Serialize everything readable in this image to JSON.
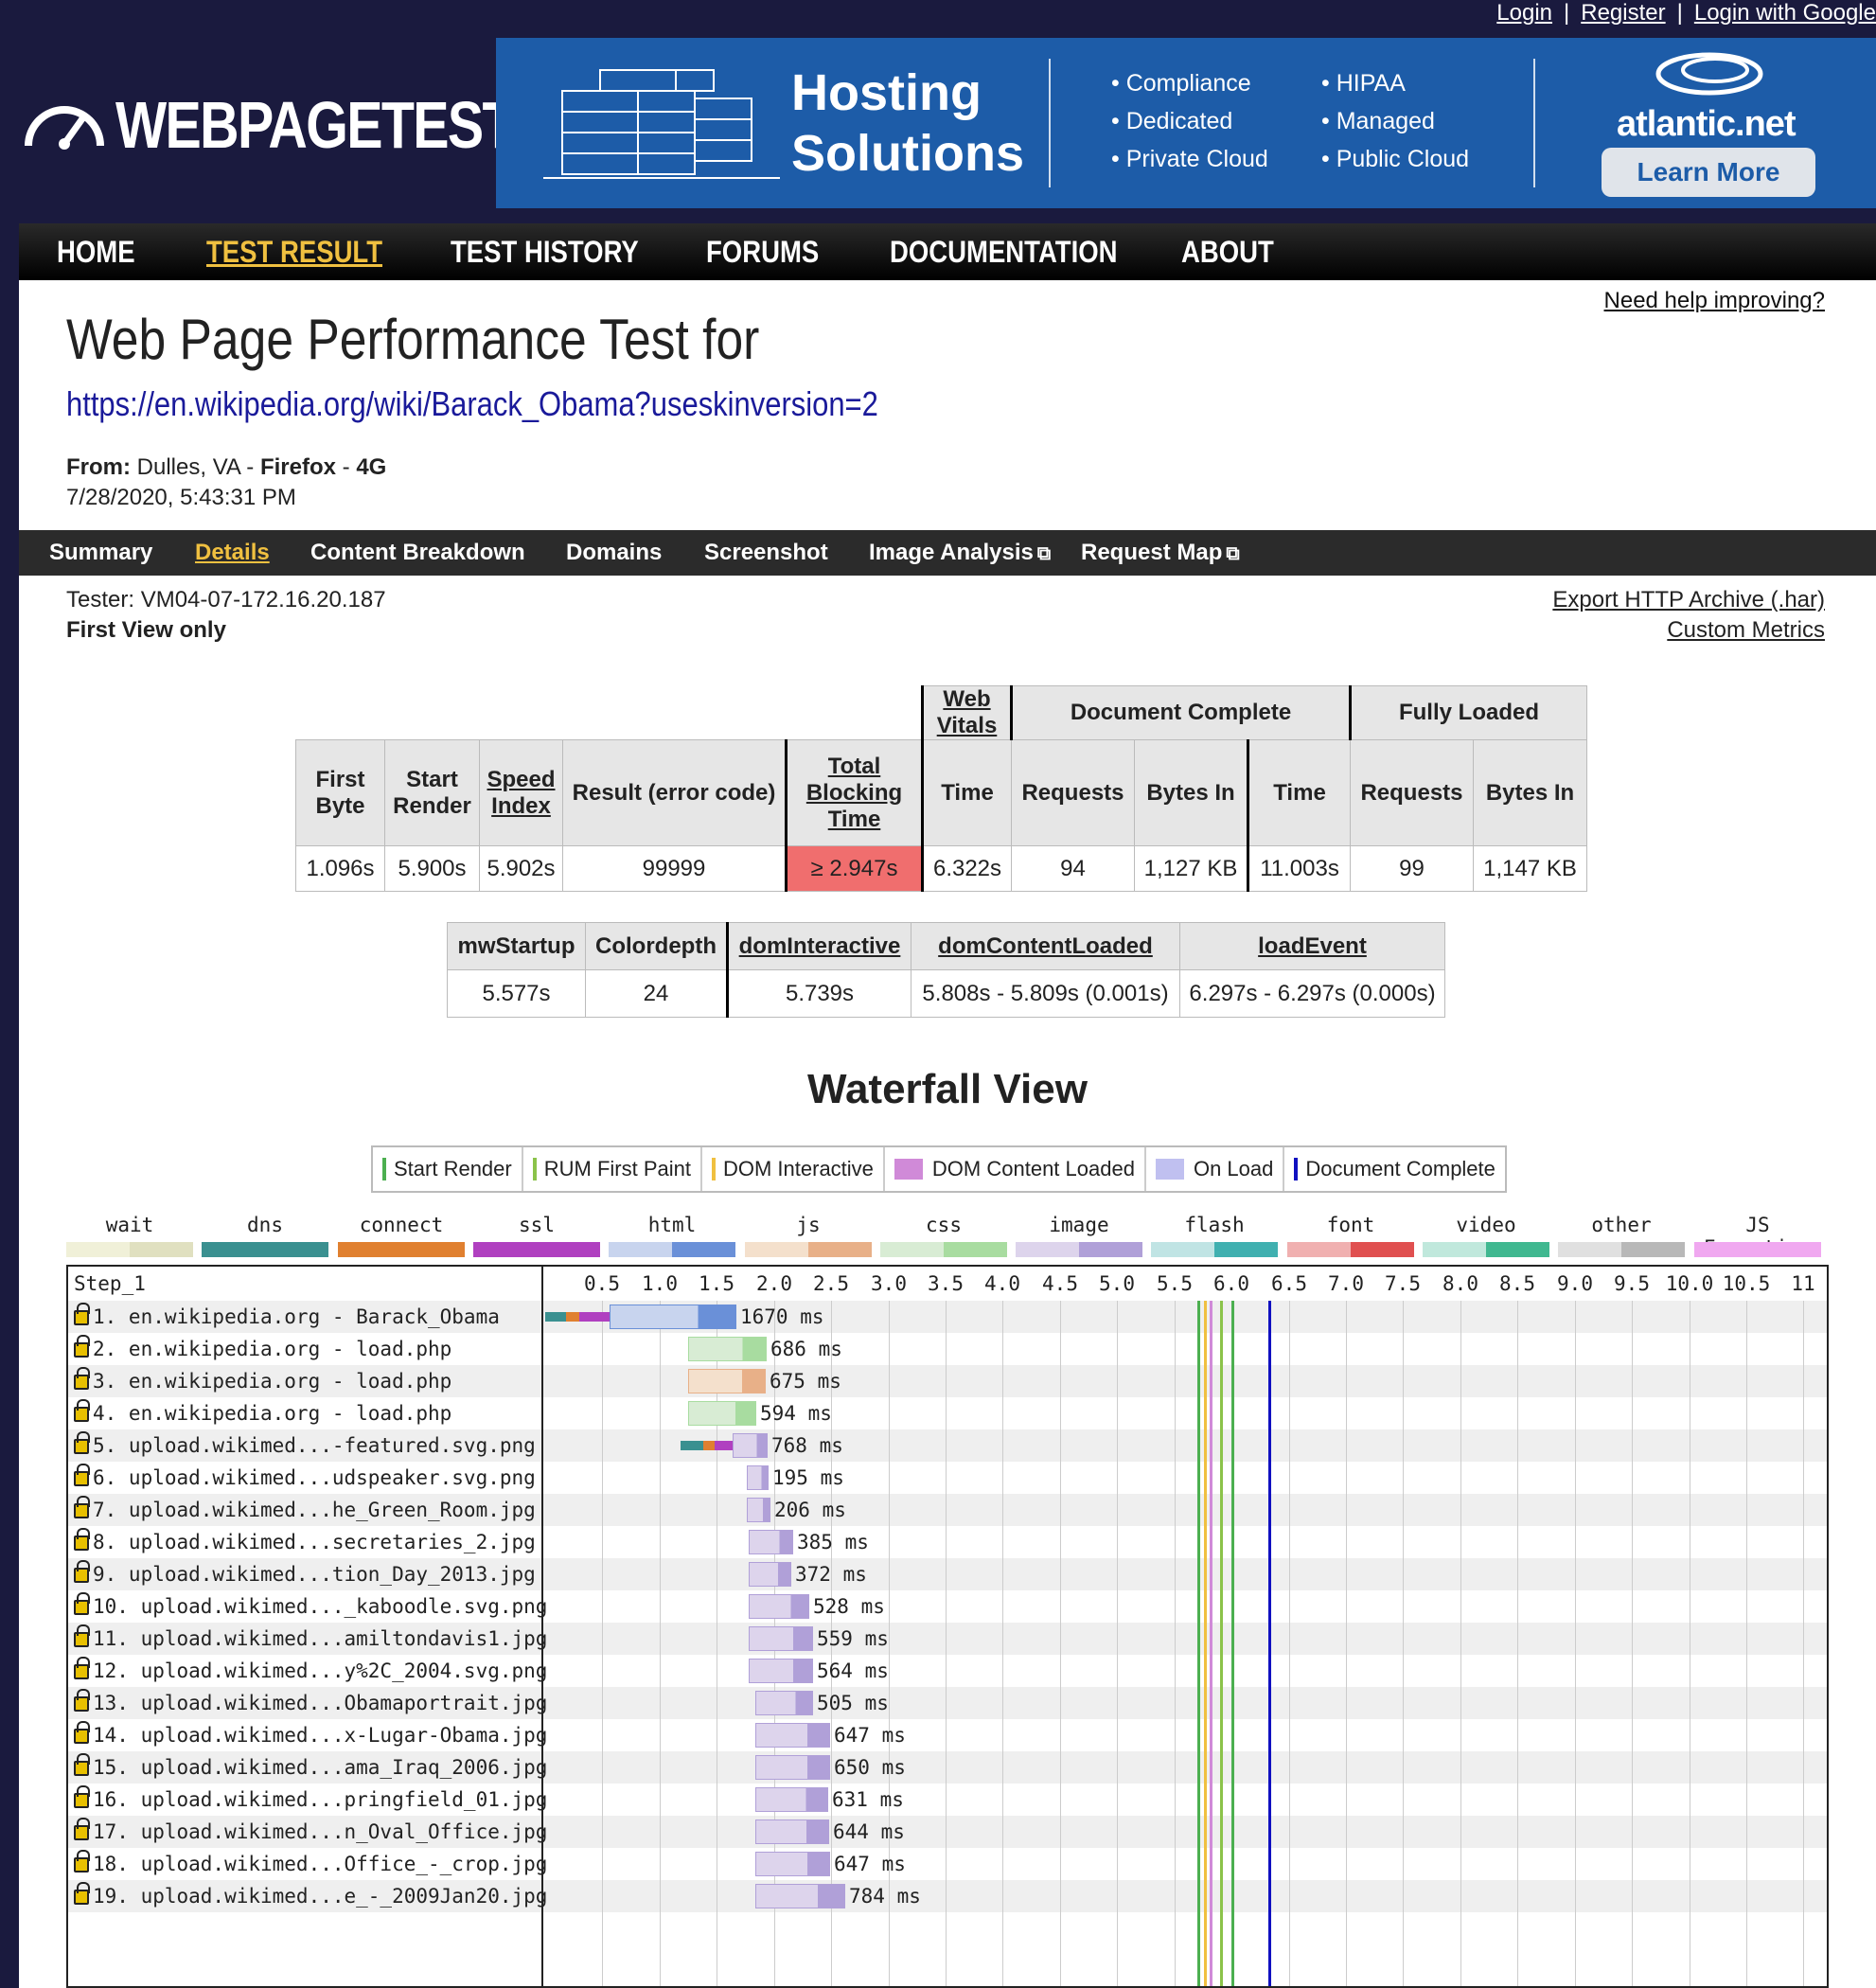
{
  "top_links": {
    "login": "Login",
    "register": "Register",
    "google": "Login with Google",
    "sep": "|"
  },
  "logo": {
    "text": "WEBPAGETEST",
    "icon": "speedometer-icon"
  },
  "ad": {
    "headline_1": "Hosting",
    "headline_2": "Solutions",
    "col1": [
      "Compliance",
      "Dedicated",
      "Private Cloud"
    ],
    "col2": [
      "HIPAA",
      "Managed",
      "Public Cloud"
    ],
    "brand": "atlantic.net",
    "cta": "Learn More",
    "icon": "server-rack-icon",
    "bg": "#1d5ca8"
  },
  "nav": {
    "items": [
      "HOME",
      "TEST RESULT",
      "TEST HISTORY",
      "FORUMS",
      "DOCUMENTATION",
      "ABOUT"
    ],
    "active": 1,
    "active_color": "#f0c040"
  },
  "help_link": "Need help improving?",
  "page_title": "Web Page Performance Test for",
  "test_url": "https://en.wikipedia.org/wiki/Barack_Obama?useskinversion=2",
  "from": {
    "label": "From:",
    "location": "Dulles, VA -",
    "browser": "Firefox",
    "dash": "-",
    "network": "4G",
    "datetime": "7/28/2020, 5:43:31 PM"
  },
  "tabs": {
    "items": [
      "Summary",
      "Details",
      "Content Breakdown",
      "Domains",
      "Screenshot",
      "Image Analysis",
      "Request Map"
    ],
    "active": 1,
    "external_icon": "external-link-icon"
  },
  "tester": "Tester: VM04-07-172.16.20.187",
  "view": "First View only",
  "export": {
    "har": "Export HTTP Archive (.har)",
    "metrics": "Custom Metrics"
  },
  "summary_table": {
    "group_headers": [
      "Web Vitals",
      "Document Complete",
      "Fully Loaded"
    ],
    "headers": [
      "First Byte",
      "Start Render",
      "Speed Index",
      "Result (error code)",
      "Total Blocking Time",
      "Time",
      "Requests",
      "Bytes In",
      "Time",
      "Requests",
      "Bytes In"
    ],
    "values": [
      "1.096s",
      "5.900s",
      "5.902s",
      "99999",
      "≥ 2.947s",
      "6.322s",
      "94",
      "1,127 KB",
      "11.003s",
      "99",
      "1,147 KB"
    ],
    "alert_color": "#f06e6e"
  },
  "metrics_table": {
    "headers": [
      "mwStartup",
      "Colordepth",
      "domInteractive",
      "domContentLoaded",
      "loadEvent"
    ],
    "values": [
      "5.577s",
      "24",
      "5.739s",
      "5.808s - 5.809s (0.001s)",
      "6.297s - 6.297s (0.000s)"
    ]
  },
  "waterfall": {
    "title": "Waterfall View",
    "event_legend": [
      {
        "label": "Start Render",
        "color": "#4caf50",
        "kind": "line"
      },
      {
        "label": "RUM First Paint",
        "color": "#8bc34a",
        "kind": "line"
      },
      {
        "label": "DOM Interactive",
        "color": "#f0c040",
        "kind": "line"
      },
      {
        "label": "DOM Content Loaded",
        "color": "#d08ad8",
        "kind": "box"
      },
      {
        "label": "On Load",
        "color": "#c0c0f0",
        "kind": "box"
      },
      {
        "label": "Document Complete",
        "color": "#1010c0",
        "kind": "line"
      }
    ],
    "type_legend": [
      {
        "label": "wait",
        "c1": "#f0f0d8",
        "c2": "#e0e0c0"
      },
      {
        "label": "dns",
        "c1": "#3a9090",
        "c2": "#3a9090"
      },
      {
        "label": "connect",
        "c1": "#e08030",
        "c2": "#e08030"
      },
      {
        "label": "ssl",
        "c1": "#b040c0",
        "c2": "#b040c0"
      },
      {
        "label": "html",
        "c1": "#c8d4ee",
        "c2": "#6a90d8"
      },
      {
        "label": "js",
        "c1": "#f4e0cc",
        "c2": "#e8b088"
      },
      {
        "label": "css",
        "c1": "#d8ecd4",
        "c2": "#a8dca0"
      },
      {
        "label": "image",
        "c1": "#ddd4ec",
        "c2": "#b0a0d8"
      },
      {
        "label": "flash",
        "c1": "#c0e4e4",
        "c2": "#40b0b0"
      },
      {
        "label": "font",
        "c1": "#f0b0b0",
        "c2": "#e05050"
      },
      {
        "label": "video",
        "c1": "#c0e8dc",
        "c2": "#40b890"
      },
      {
        "label": "other",
        "c1": "#e0e0e0",
        "c2": "#b8b8b8"
      },
      {
        "label": "JS Execution",
        "c1": "#f0a8f0",
        "c2": "#f0a8f0"
      }
    ],
    "step": "Step_1",
    "ticks": [
      "0.5",
      "1.0",
      "1.5",
      "2.0",
      "2.5",
      "3.0",
      "3.5",
      "4.0",
      "4.5",
      "5.0",
      "5.5",
      "6.0",
      "6.5",
      "7.0",
      "7.5",
      "8.0",
      "8.5",
      "9.0",
      "9.5",
      "10.0",
      "10.5",
      "11"
    ],
    "events": [
      {
        "t": 5.7,
        "color": "#4caf50"
      },
      {
        "t": 5.76,
        "color": "#f0c040"
      },
      {
        "t": 5.81,
        "color": "#d08ad8"
      },
      {
        "t": 5.9,
        "color": "#8bc34a"
      },
      {
        "t": 6.0,
        "color": "#4caf50"
      },
      {
        "t": 6.32,
        "color": "#1010c0"
      }
    ],
    "requests": [
      {
        "label": "1. en.wikipedia.org - Barack_Obama",
        "start": 0.0,
        "dur": 1.67,
        "ms": "1670 ms",
        "type": "html",
        "pre": [
          0.18,
          0.12,
          0.26
        ]
      },
      {
        "label": "2. en.wikipedia.org - load.php",
        "start": 1.25,
        "dur": 0.686,
        "ms": "686 ms",
        "type": "css"
      },
      {
        "label": "3. en.wikipedia.org - load.php",
        "start": 1.25,
        "dur": 0.675,
        "ms": "675 ms",
        "type": "js"
      },
      {
        "label": "4. en.wikipedia.org - load.php",
        "start": 1.25,
        "dur": 0.594,
        "ms": "594 ms",
        "type": "css"
      },
      {
        "label": "5. upload.wikimed...-featured.svg.png",
        "start": 1.18,
        "dur": 0.768,
        "ms": "768 ms",
        "type": "image",
        "pre": [
          0.2,
          0.1,
          0.16
        ]
      },
      {
        "label": "6. upload.wikimed...udspeaker.svg.png",
        "start": 1.76,
        "dur": 0.195,
        "ms": "195 ms",
        "type": "image"
      },
      {
        "label": "7. upload.wikimed...he_Green_Room.jpg",
        "start": 1.76,
        "dur": 0.206,
        "ms": "206 ms",
        "type": "image"
      },
      {
        "label": "8. upload.wikimed...secretaries_2.jpg",
        "start": 1.78,
        "dur": 0.385,
        "ms": "385 ms",
        "type": "image"
      },
      {
        "label": "9. upload.wikimed...tion_Day_2013.jpg",
        "start": 1.78,
        "dur": 0.372,
        "ms": "372 ms",
        "type": "image"
      },
      {
        "label": "10. upload.wikimed..._kaboodle.svg.png",
        "start": 1.78,
        "dur": 0.528,
        "ms": "528 ms",
        "type": "image"
      },
      {
        "label": "11. upload.wikimed...amiltondavis1.jpg",
        "start": 1.78,
        "dur": 0.559,
        "ms": "559 ms",
        "type": "image"
      },
      {
        "label": "12. upload.wikimed...y%2C_2004.svg.png",
        "start": 1.78,
        "dur": 0.564,
        "ms": "564 ms",
        "type": "image"
      },
      {
        "label": "13. upload.wikimed...Obamaportrait.jpg",
        "start": 1.84,
        "dur": 0.505,
        "ms": "505 ms",
        "type": "image"
      },
      {
        "label": "14. upload.wikimed...x-Lugar-Obama.jpg",
        "start": 1.84,
        "dur": 0.647,
        "ms": "647 ms",
        "type": "image"
      },
      {
        "label": "15. upload.wikimed...ama_Iraq_2006.jpg",
        "start": 1.84,
        "dur": 0.65,
        "ms": "650 ms",
        "type": "image"
      },
      {
        "label": "16. upload.wikimed...pringfield_01.jpg",
        "start": 1.84,
        "dur": 0.631,
        "ms": "631 ms",
        "type": "image"
      },
      {
        "label": "17. upload.wikimed...n_Oval_Office.jpg",
        "start": 1.84,
        "dur": 0.644,
        "ms": "644 ms",
        "type": "image"
      },
      {
        "label": "18. upload.wikimed...Office_-_crop.jpg",
        "start": 1.84,
        "dur": 0.647,
        "ms": "647 ms",
        "type": "image"
      },
      {
        "label": "19. upload.wikimed...e_-_2009Jan20.jpg",
        "start": 1.84,
        "dur": 0.784,
        "ms": "784 ms",
        "type": "image"
      }
    ]
  }
}
